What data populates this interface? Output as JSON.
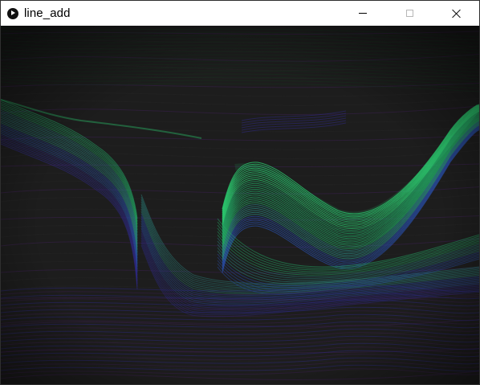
{
  "window": {
    "title": "line_add",
    "icon": "processing-play-icon",
    "controls": [
      "minimize-icon",
      "maximize-icon",
      "close-icon"
    ]
  },
  "canvas": {
    "background": "#1b1b1b",
    "palette": {
      "green_bright": "#2ee27a",
      "green": "#23b36a",
      "teal": "#2c8c86",
      "blue": "#2a4ea8",
      "indigo": "#2f2a8a",
      "purple": "#3b1f52",
      "dark_green": "#16361f"
    }
  }
}
